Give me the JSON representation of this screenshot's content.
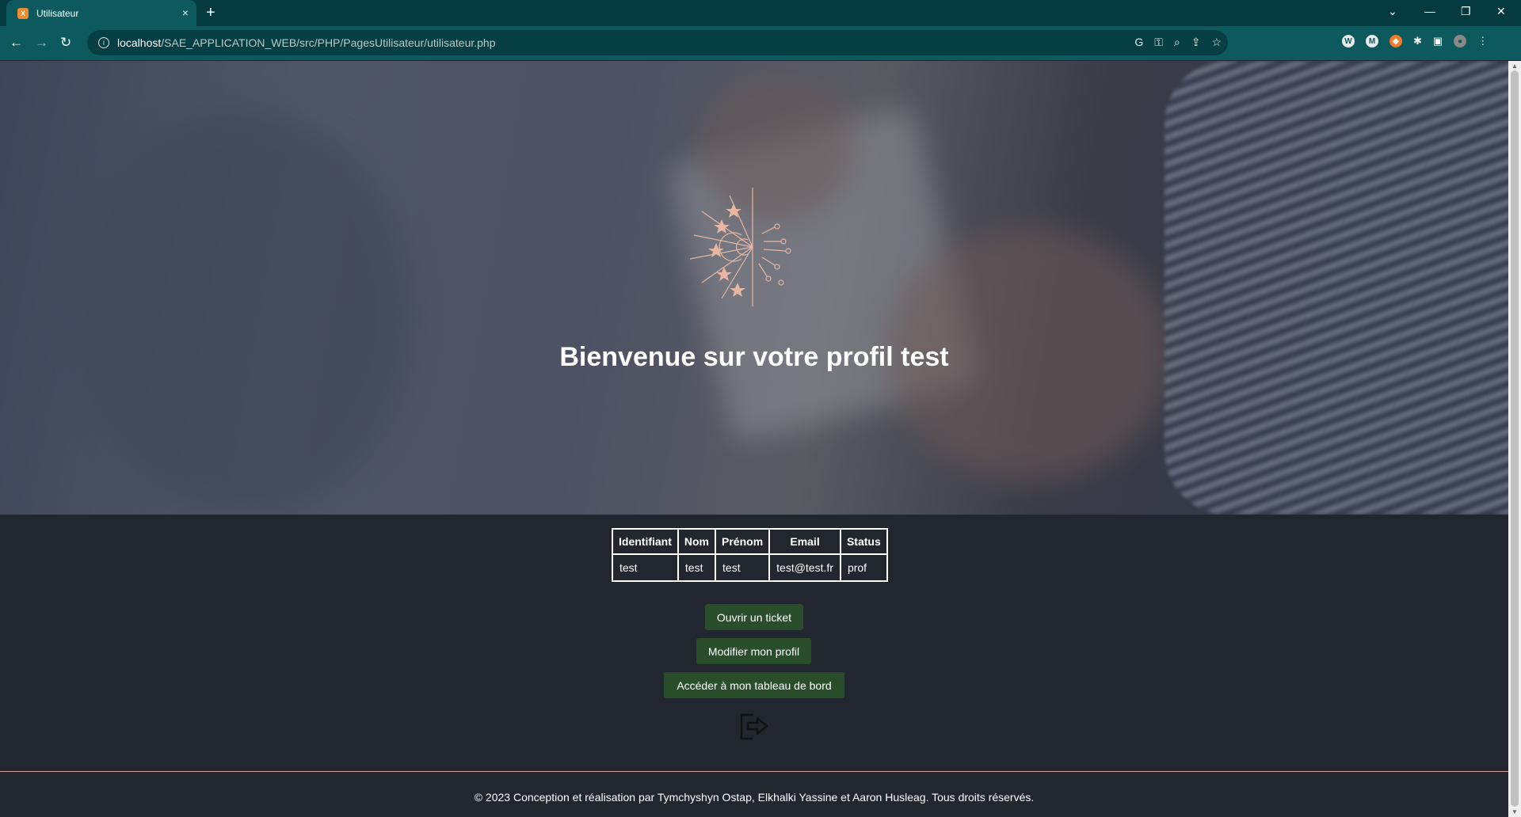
{
  "browser": {
    "tab_title": "Utilisateur",
    "favicon_letter": "X",
    "new_tab": "+",
    "close_tab": "×",
    "url_host": "localhost",
    "url_path": "/SAE_APPLICATION_WEB/src/PHP/PagesUtilisateur/utilisateur.php",
    "omnibox_icons": [
      "google-icon",
      "key-icon",
      "zoom-icon",
      "share-icon",
      "star-icon"
    ],
    "extension_icons": [
      "extension-w-icon",
      "extension-m-icon",
      "extension-orange-icon",
      "puzzle-icon",
      "sidepanel-icon",
      "profile-avatar",
      "menu-icon"
    ]
  },
  "hero": {
    "title": "Bienvenue sur votre profil test"
  },
  "table": {
    "headers": [
      "Identifiant",
      "Nom",
      "Prénom",
      "Email",
      "Status"
    ],
    "row": [
      "test",
      "test",
      "test",
      "test@test.fr",
      "prof"
    ]
  },
  "actions": {
    "open_ticket": "Ouvrir un ticket",
    "edit_profile": "Modifier mon profil",
    "dashboard": "Accéder à mon tableau de bord"
  },
  "footer": {
    "text": "© 2023 Conception et réalisation par Tymchyshyn Ostap, Elkhalki Yassine et Aaron Husleag. Tous droits réservés."
  },
  "colors": {
    "chrome": "#0c5a5d",
    "tabbar": "#033a3f",
    "page_bg": "#22262f",
    "button_bg": "#2a4d2c",
    "logo": "#e8b7a3"
  }
}
